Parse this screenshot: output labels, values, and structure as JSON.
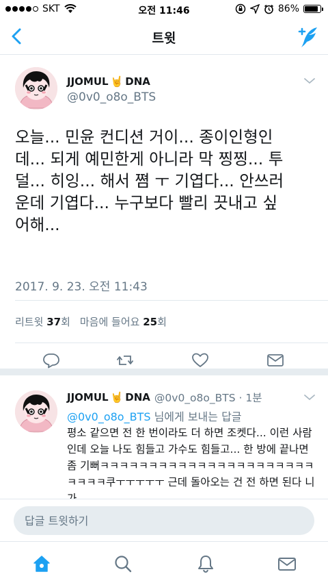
{
  "status_bar": {
    "carrier": "SKT",
    "time": "오전 11:46",
    "battery": "86%",
    "battery_level": 0.86
  },
  "nav": {
    "title": "트윗",
    "back_icon": "chevron-left-icon",
    "compose_icon": "compose-tweet-icon"
  },
  "main_tweet": {
    "display_name": "JJOMUL",
    "name_suffix": "DNA",
    "name_emoji": "🤘",
    "handle": "@0v0_o8o_BTS",
    "text": "오늘... 민윤 컨디션 거이... 종이인형인\n데... 되게 예민한게 아니라 막 찡찡... 투\n덜... 히잉... 해서 쪔 ㅜ 기엽다... 안쓰러\n운데 기엽다... 누구보다 빨리 끗내고 싶\n어해...",
    "timestamp": "2017. 9. 23. 오전 11:43",
    "retweets_label": "리트윗",
    "retweets_count": "37",
    "retweets_unit": "회",
    "likes_label": "마음에 들어요",
    "likes_count": "25",
    "likes_unit": "회"
  },
  "reply": {
    "display_name": "JJOMUL",
    "name_suffix": "DNA",
    "name_emoji": "🤘",
    "handle_time": "@0v0_o8o_BTS · 1분",
    "reply_to_mention": "@0v0_o8o_BTS",
    "reply_to_suffix": " 님에게 보내는 답글",
    "text": "평소 같으면 전 한 번이라도 더 하면 조켓다... 이런 사람인데 오늘 나도 힘들고 가수도 힘들고... 한 방에 끝나면 좀 기뻐ㅋㅋㅋㅋㅋㅋㅋㅋㅋㅋㅋㅋㅋㅋㅋㅋㅋㅋㅋㅋㅋㅋㅋㅋㅋㅋ쿠ㅜㅜㅜㅜㅜ 근데 돌아오는 건 전 하면 된다 니가..."
  },
  "reply_bar": {
    "placeholder": "답글 트윗하기"
  },
  "tabs": [
    "home-icon",
    "search-icon",
    "notifications-icon",
    "messages-icon"
  ],
  "colors": {
    "accent": "#1da1f2",
    "text": "#14171a",
    "muted": "#657786",
    "divider": "#e1e8ed"
  }
}
